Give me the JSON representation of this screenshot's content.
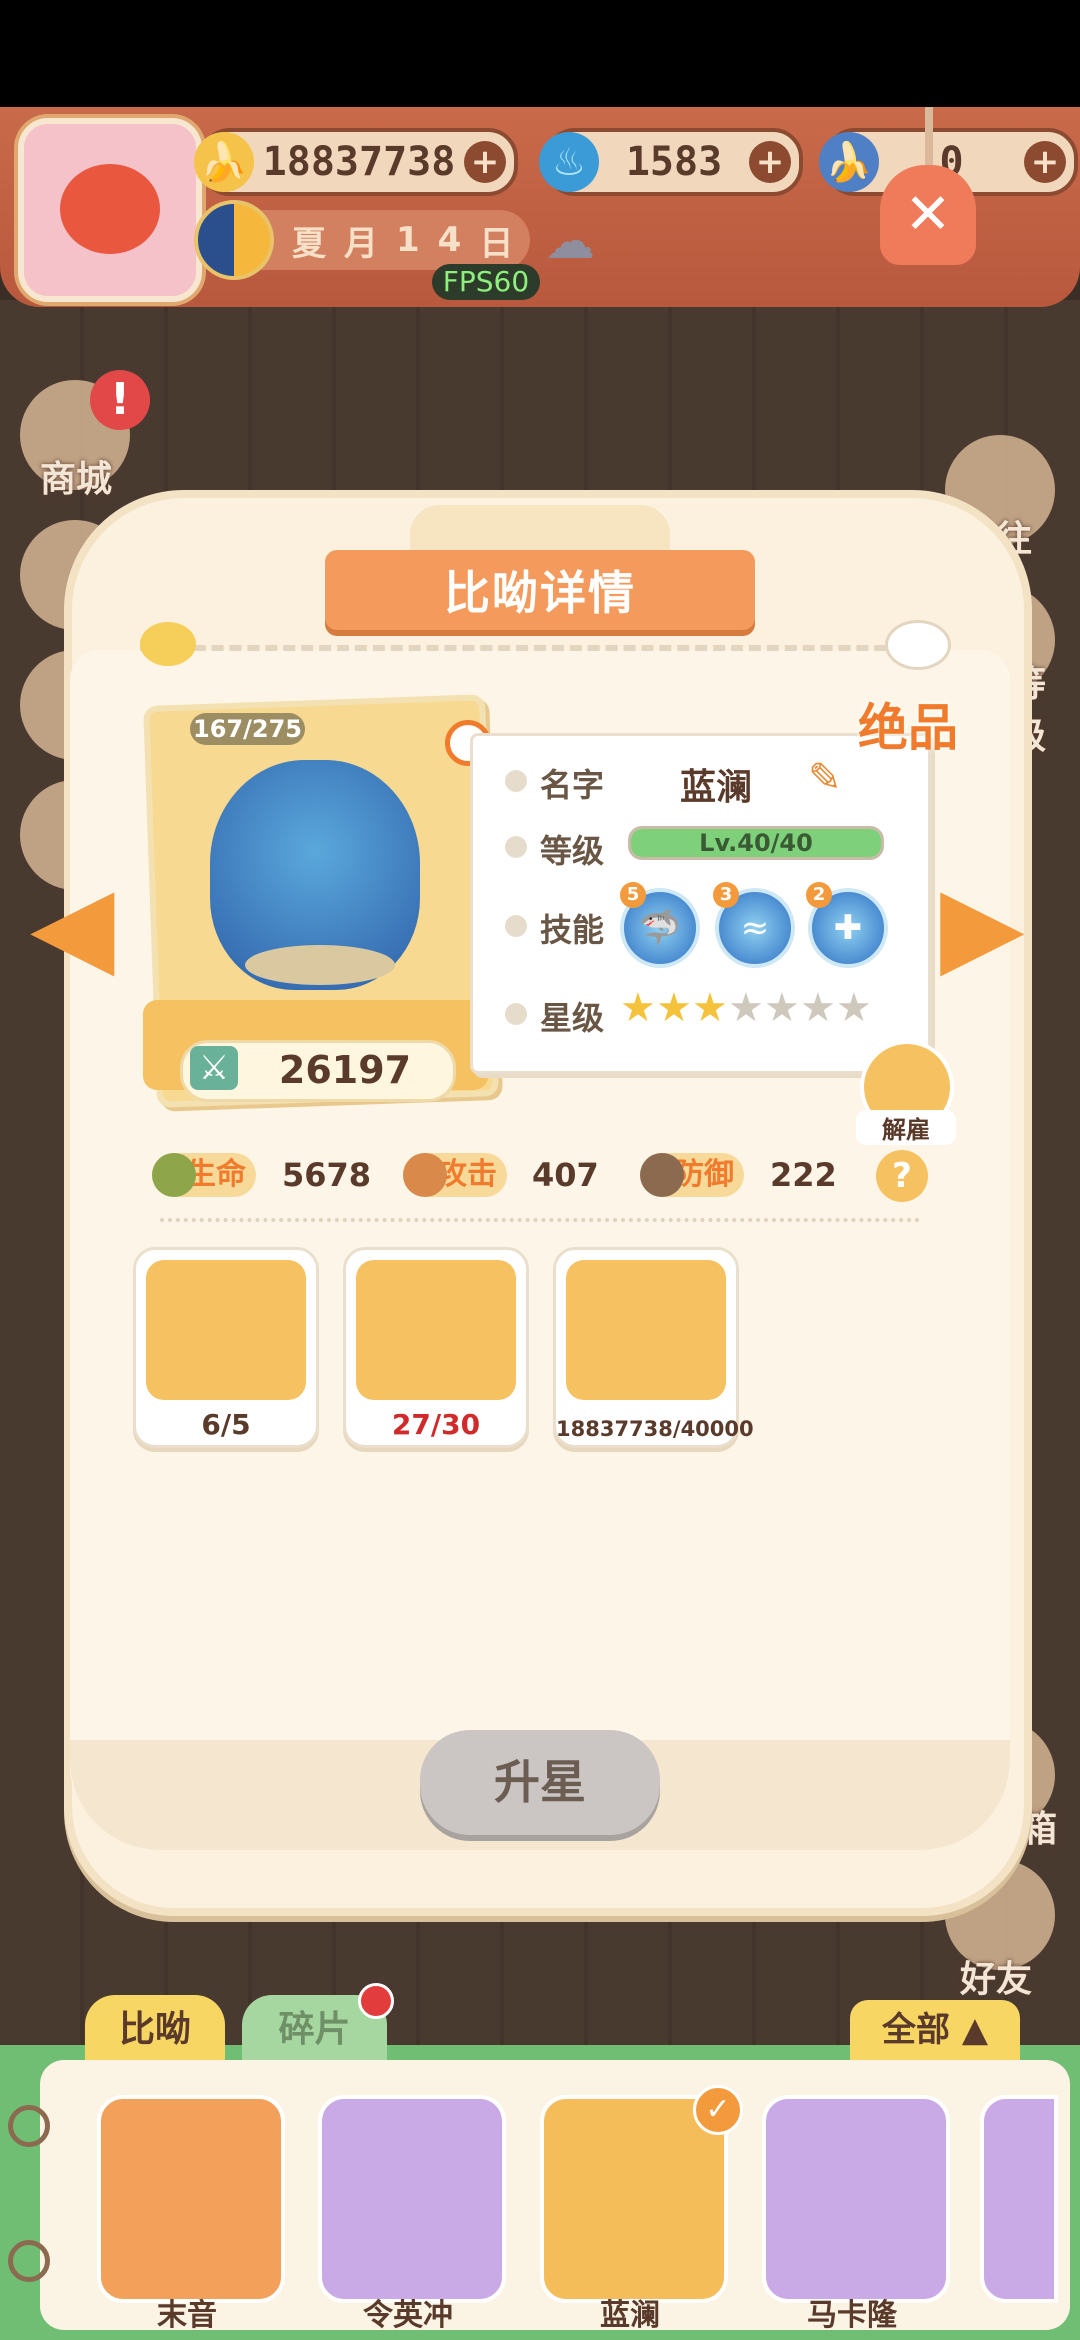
{
  "hud": {
    "currencies": [
      {
        "icon": "banana-icon",
        "value": "18837738"
      },
      {
        "icon": "blue-flame-icon",
        "value": "1583"
      },
      {
        "icon": "blue-banana-icon",
        "value": "0"
      }
    ],
    "date": [
      "夏",
      "月",
      "1",
      "4",
      "日"
    ],
    "fps": "FPS60",
    "weather_icon": "rain-cloud-icon"
  },
  "side_left": [
    {
      "label": "商城"
    }
  ],
  "side_right": [
    {
      "label": "前往"
    },
    {
      "label": "等级"
    },
    {
      "label": "邮箱"
    },
    {
      "label": "好友"
    }
  ],
  "dialog": {
    "title": "比呦详情",
    "grade": "绝品",
    "fragments_progress": "167/275",
    "power": "26197",
    "labels": {
      "name": "名字",
      "level": "等级",
      "skills": "技能",
      "stars": "星级"
    },
    "name": "蓝澜",
    "level_text": "Lv.40/40",
    "level_fraction": 1.0,
    "skills": [
      {
        "level": "5",
        "icon": "shark-skill-icon"
      },
      {
        "level": "3",
        "icon": "wave-skill-icon"
      },
      {
        "level": "2",
        "icon": "heal-cross-skill-icon"
      }
    ],
    "stars_filled": 3,
    "stars_total": 7,
    "dismiss_label": "解雇",
    "stats": [
      {
        "label": "生命",
        "value": "5678"
      },
      {
        "label": "攻击",
        "value": "407"
      },
      {
        "label": "防御",
        "value": "222"
      }
    ],
    "help": "?",
    "materials": [
      {
        "icon": "statue-icon",
        "count": "6/5"
      },
      {
        "icon": "hero-fragment-icon",
        "count": "27/30"
      },
      {
        "icon": "banana-icon",
        "count": "18837738/40000"
      }
    ],
    "upgrade_label": "升星"
  },
  "roster": {
    "tabs": [
      "比呦",
      "碎片"
    ],
    "filter_label": "全部 ▲",
    "heroes": [
      {
        "name": "末音",
        "color": "#f3a05b"
      },
      {
        "name": "令英冲",
        "color": "#c9a9e6"
      },
      {
        "name": "蓝澜",
        "color": "#f5bd5a"
      },
      {
        "name": "马卡隆",
        "color": "#c9a9e6"
      }
    ]
  }
}
